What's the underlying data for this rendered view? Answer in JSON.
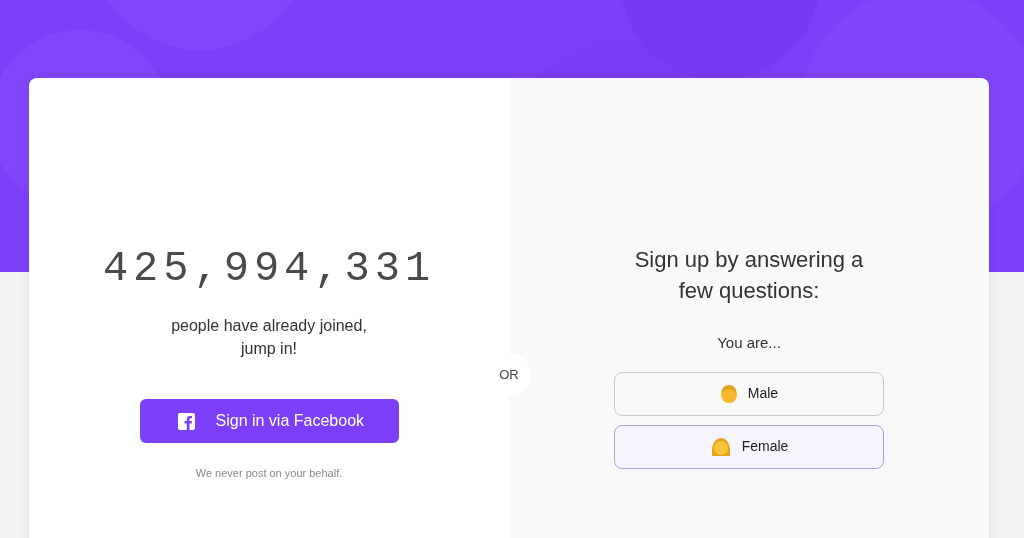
{
  "signup_count": {
    "number": "425,994,331",
    "caption": "people have already joined,",
    "caption_line_2": "jump in!"
  },
  "facebook_button": {
    "label": "Sign in via Facebook"
  },
  "disclaimer": "We never post on your behalf.",
  "divider_label": "OR",
  "questionnaire": {
    "heading": "Sign up by answering a",
    "heading_line_2": "few questions:",
    "prompt": "You are...",
    "options": [
      {
        "label": "Male",
        "kind": "man",
        "selected": false
      },
      {
        "label": "Female",
        "kind": "woman",
        "selected": true
      }
    ]
  }
}
